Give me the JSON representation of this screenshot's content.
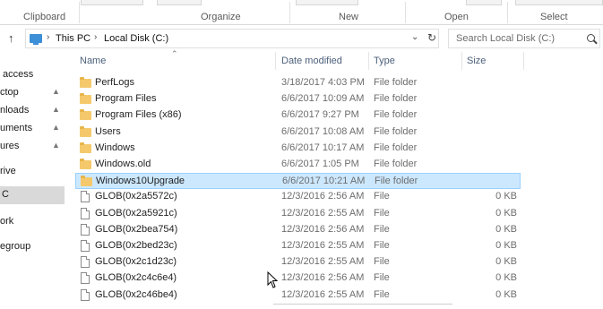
{
  "ribbon": {
    "groups": [
      {
        "label": "Clipboard"
      },
      {
        "label": "Organize"
      },
      {
        "label": "New"
      },
      {
        "label": "Open"
      },
      {
        "label": "Select"
      }
    ]
  },
  "address": {
    "crumbs": [
      "This PC",
      "Local Disk (C:)"
    ],
    "search_placeholder": "Search Local Disk (C:)"
  },
  "nav_pane": {
    "items": [
      {
        "label": "access",
        "pinned": false
      },
      {
        "label": "ctop",
        "pinned": true
      },
      {
        "label": "nloads",
        "pinned": true
      },
      {
        "label": "uments",
        "pinned": true
      },
      {
        "label": "ures",
        "pinned": true
      },
      {
        "label": "rive",
        "pinned": false
      },
      {
        "label": "C",
        "pinned": false,
        "selected": true
      },
      {
        "label": "ork",
        "pinned": false
      },
      {
        "label": "egroup",
        "pinned": false
      }
    ]
  },
  "file_list": {
    "columns": {
      "name": "Name",
      "date": "Date modified",
      "type": "Type",
      "size": "Size"
    },
    "rows": [
      {
        "name": "PerfLogs",
        "date": "3/18/2017 4:03 PM",
        "type": "File folder",
        "size": "",
        "kind": "folder"
      },
      {
        "name": "Program Files",
        "date": "6/6/2017 10:09 AM",
        "type": "File folder",
        "size": "",
        "kind": "folder"
      },
      {
        "name": "Program Files (x86)",
        "date": "6/6/2017 9:27 PM",
        "type": "File folder",
        "size": "",
        "kind": "folder"
      },
      {
        "name": "Users",
        "date": "6/6/2017 10:08 AM",
        "type": "File folder",
        "size": "",
        "kind": "folder"
      },
      {
        "name": "Windows",
        "date": "6/6/2017 10:17 AM",
        "type": "File folder",
        "size": "",
        "kind": "folder"
      },
      {
        "name": "Windows.old",
        "date": "6/6/2017 1:05 PM",
        "type": "File folder",
        "size": "",
        "kind": "folder"
      },
      {
        "name": "Windows10Upgrade",
        "date": "6/6/2017 10:21 AM",
        "type": "File folder",
        "size": "",
        "kind": "folder",
        "selected": true
      },
      {
        "name": "GLOB(0x2a5572c)",
        "date": "12/3/2016 2:56 AM",
        "type": "File",
        "size": "0 KB",
        "kind": "file"
      },
      {
        "name": "GLOB(0x2a5921c)",
        "date": "12/3/2016 2:55 AM",
        "type": "File",
        "size": "0 KB",
        "kind": "file"
      },
      {
        "name": "GLOB(0x2bea754)",
        "date": "12/3/2016 2:56 AM",
        "type": "File",
        "size": "0 KB",
        "kind": "file"
      },
      {
        "name": "GLOB(0x2bed23c)",
        "date": "12/3/2016 2:55 AM",
        "type": "File",
        "size": "0 KB",
        "kind": "file"
      },
      {
        "name": "GLOB(0x2c1d23c)",
        "date": "12/3/2016 2:55 AM",
        "type": "File",
        "size": "0 KB",
        "kind": "file"
      },
      {
        "name": "GLOB(0x2c4c6e4)",
        "date": "12/3/2016 2:56 AM",
        "type": "File",
        "size": "0 KB",
        "kind": "file"
      },
      {
        "name": "GLOB(0x2c46be4)",
        "date": "12/3/2016 2:55 AM",
        "type": "File",
        "size": "0 KB",
        "kind": "file"
      }
    ]
  },
  "colors": {
    "selection_bg": "#cce8ff",
    "selection_border": "#99d1ff",
    "folder": "#f5c96b",
    "header_text": "#4c607a"
  }
}
